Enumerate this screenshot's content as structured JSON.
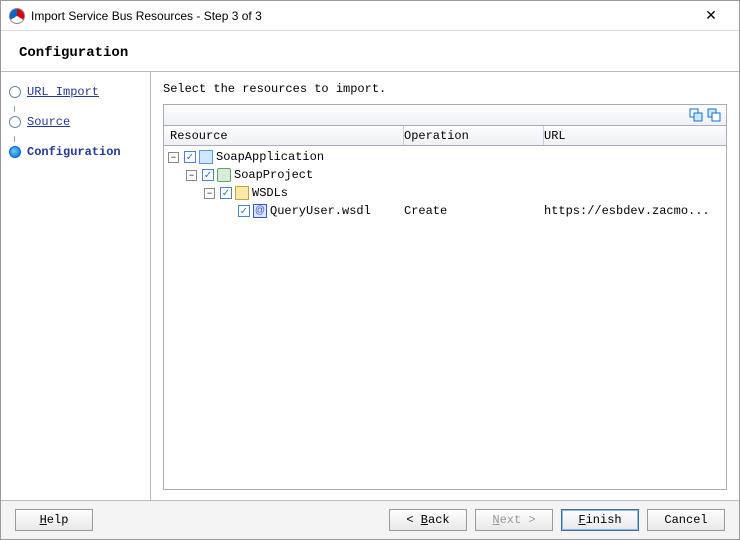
{
  "window": {
    "title": "Import Service Bus Resources - Step 3 of 3"
  },
  "header": {
    "title": "Configuration"
  },
  "sidebar": {
    "steps": [
      {
        "label": "URL Import"
      },
      {
        "label": "Source"
      },
      {
        "label": "Configuration"
      }
    ]
  },
  "main": {
    "instruction": "Select the resources to import.",
    "columns": {
      "resource": "Resource",
      "operation": "Operation",
      "url": "URL"
    },
    "tree": {
      "app": {
        "label": "SoapApplication",
        "checked": true
      },
      "project": {
        "label": "SoapProject",
        "checked": true
      },
      "folder": {
        "label": "WSDLs",
        "checked": true
      },
      "file": {
        "label": "QueryUser.wsdl",
        "checked": true,
        "operation": "Create",
        "url": "https://esbdev.zacmo..."
      }
    }
  },
  "footer": {
    "help": "Help",
    "back": "Back",
    "next": "Next",
    "finish": "Finish",
    "cancel": "Cancel"
  }
}
